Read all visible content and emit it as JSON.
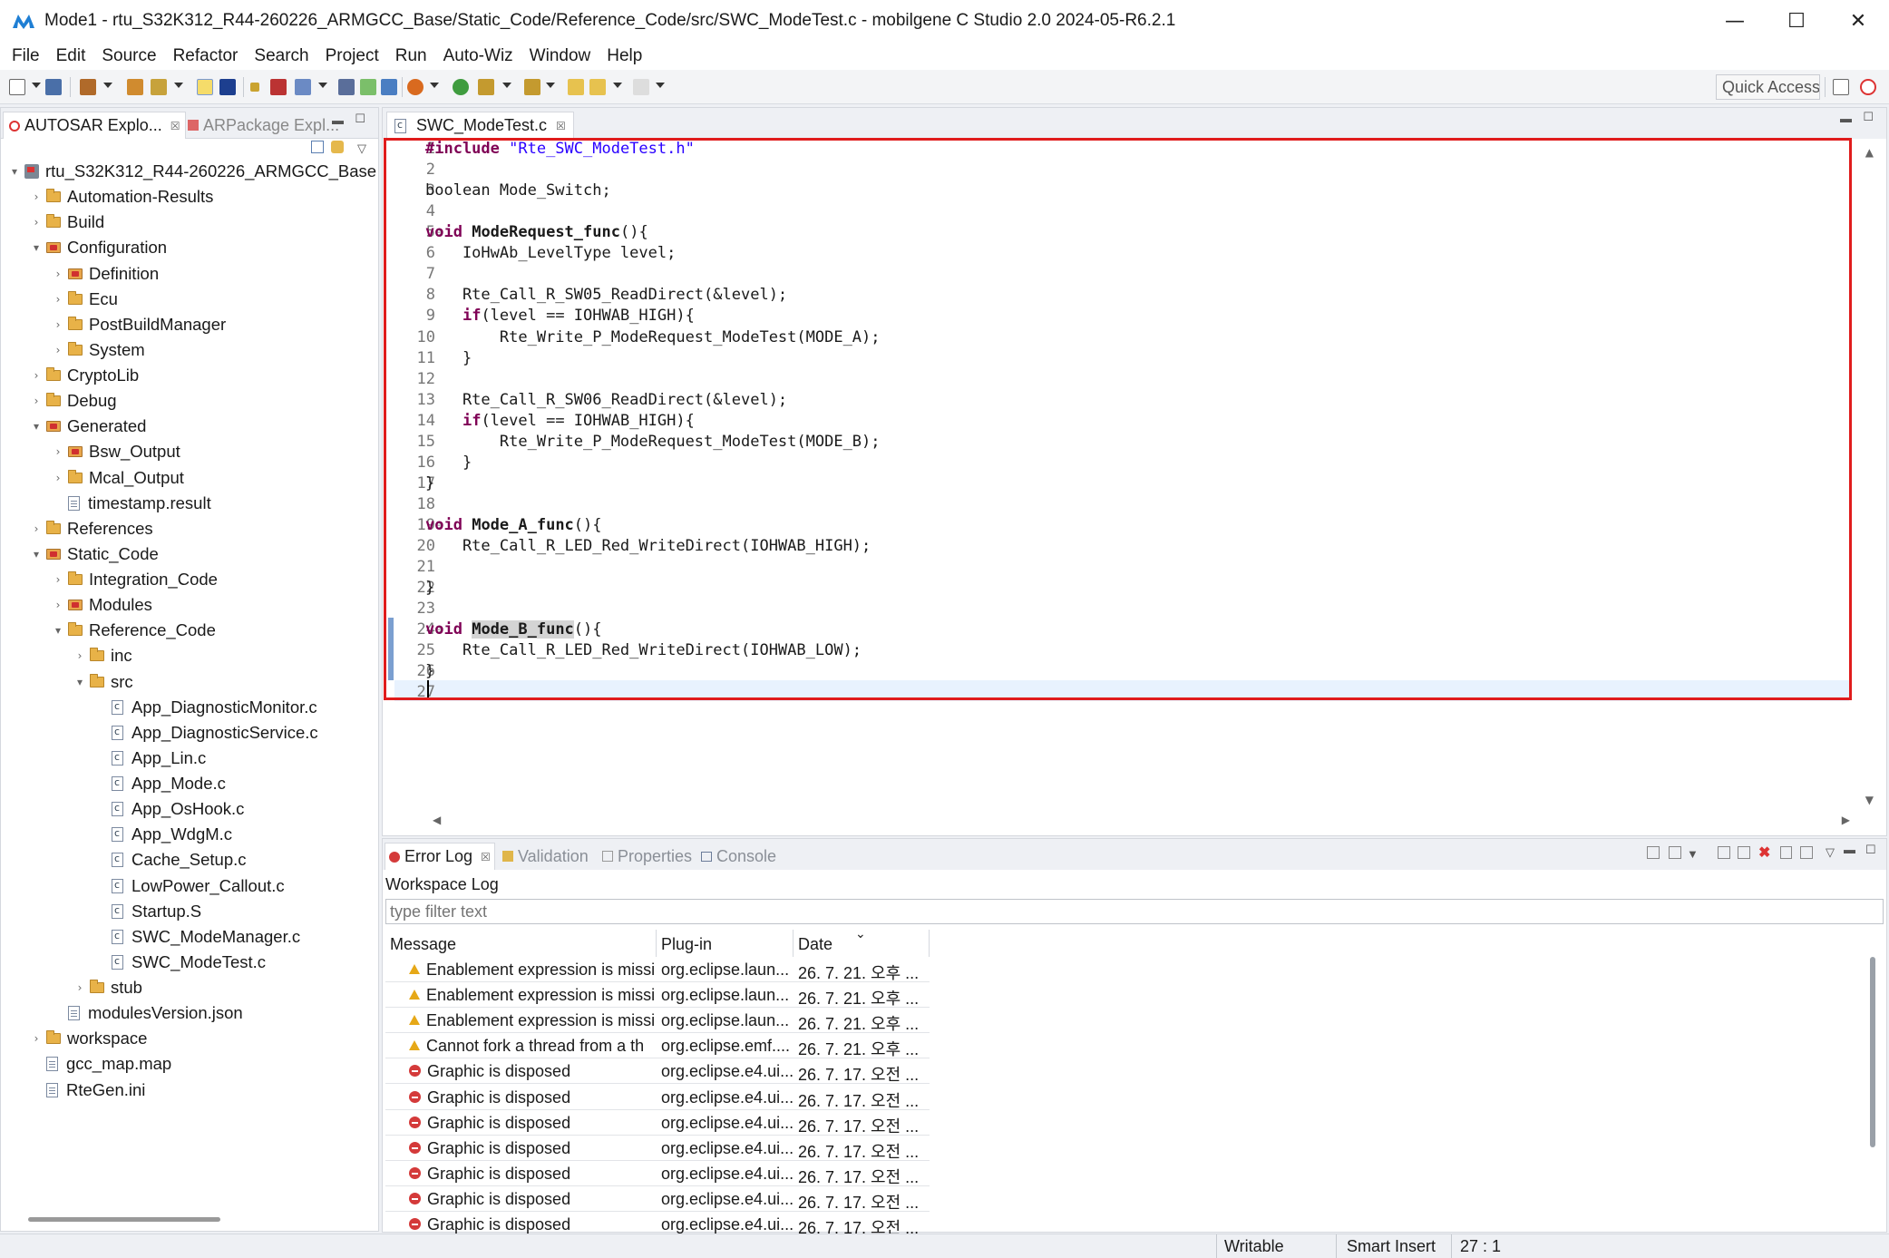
{
  "window": {
    "title": "Mode1 - rtu_S32K312_R44-260226_ARMGCC_Base/Static_Code/Reference_Code/src/SWC_ModeTest.c - mobilgene C Studio 2.0 2024-05-R6.2.1",
    "minimize": "—",
    "maximize": "☐",
    "close": "✕"
  },
  "menu": [
    "File",
    "Edit",
    "Source",
    "Refactor",
    "Search",
    "Project",
    "Run",
    "Auto-Wiz",
    "Window",
    "Help"
  ],
  "toolbar": {
    "quick_access": "Quick Access"
  },
  "left_panel": {
    "tabs": [
      {
        "label": "AUTOSAR Explo...",
        "close": "☒"
      },
      {
        "label": "ARPackage Expl...",
        "close": ""
      }
    ],
    "tree": [
      {
        "label": "rtu_S32K312_R44-260226_ARMGCC_Base",
        "depth": 0,
        "chev": "▾",
        "icon": "project-icon"
      },
      {
        "label": "Automation-Results",
        "depth": 1,
        "chev": "›",
        "icon": "folder-icon"
      },
      {
        "label": "Build",
        "depth": 1,
        "chev": "›",
        "icon": "folder-icon"
      },
      {
        "label": "Configuration",
        "depth": 1,
        "chev": "▾",
        "icon": "source-folder-icon"
      },
      {
        "label": "Definition",
        "depth": 2,
        "chev": "›",
        "icon": "source-folder-icon"
      },
      {
        "label": "Ecu",
        "depth": 2,
        "chev": "›",
        "icon": "folder-icon"
      },
      {
        "label": "PostBuildManager",
        "depth": 2,
        "chev": "›",
        "icon": "folder-icon"
      },
      {
        "label": "System",
        "depth": 2,
        "chev": "›",
        "icon": "folder-icon"
      },
      {
        "label": "CryptoLib",
        "depth": 1,
        "chev": "›",
        "icon": "folder-icon"
      },
      {
        "label": "Debug",
        "depth": 1,
        "chev": "›",
        "icon": "folder-icon"
      },
      {
        "label": "Generated",
        "depth": 1,
        "chev": "▾",
        "icon": "source-folder-icon"
      },
      {
        "label": "Bsw_Output",
        "depth": 2,
        "chev": "›",
        "icon": "source-folder-icon"
      },
      {
        "label": "Mcal_Output",
        "depth": 2,
        "chev": "›",
        "icon": "folder-icon"
      },
      {
        "label": "timestamp.result",
        "depth": 2,
        "chev": "",
        "icon": "file-icon"
      },
      {
        "label": "References",
        "depth": 1,
        "chev": "›",
        "icon": "folder-icon"
      },
      {
        "label": "Static_Code",
        "depth": 1,
        "chev": "▾",
        "icon": "source-folder-icon"
      },
      {
        "label": "Integration_Code",
        "depth": 2,
        "chev": "›",
        "icon": "folder-icon"
      },
      {
        "label": "Modules",
        "depth": 2,
        "chev": "›",
        "icon": "source-folder-icon"
      },
      {
        "label": "Reference_Code",
        "depth": 2,
        "chev": "▾",
        "icon": "folder-icon"
      },
      {
        "label": "inc",
        "depth": 3,
        "chev": "›",
        "icon": "folder-icon"
      },
      {
        "label": "src",
        "depth": 3,
        "chev": "▾",
        "icon": "folder-icon"
      },
      {
        "label": "App_DiagnosticMonitor.c",
        "depth": 4,
        "chev": "",
        "icon": "c-file-icon"
      },
      {
        "label": "App_DiagnosticService.c",
        "depth": 4,
        "chev": "",
        "icon": "c-file-icon"
      },
      {
        "label": "App_Lin.c",
        "depth": 4,
        "chev": "",
        "icon": "c-file-icon"
      },
      {
        "label": "App_Mode.c",
        "depth": 4,
        "chev": "",
        "icon": "c-file-icon"
      },
      {
        "label": "App_OsHook.c",
        "depth": 4,
        "chev": "",
        "icon": "c-file-icon"
      },
      {
        "label": "App_WdgM.c",
        "depth": 4,
        "chev": "",
        "icon": "c-file-icon"
      },
      {
        "label": "Cache_Setup.c",
        "depth": 4,
        "chev": "",
        "icon": "c-file-icon"
      },
      {
        "label": "LowPower_Callout.c",
        "depth": 4,
        "chev": "",
        "icon": "c-file-icon"
      },
      {
        "label": "Startup.S",
        "depth": 4,
        "chev": "",
        "icon": "c-file-icon"
      },
      {
        "label": "SWC_ModeManager.c",
        "depth": 4,
        "chev": "",
        "icon": "c-file-icon"
      },
      {
        "label": "SWC_ModeTest.c",
        "depth": 4,
        "chev": "",
        "icon": "c-file-icon"
      },
      {
        "label": "stub",
        "depth": 3,
        "chev": "›",
        "icon": "folder-icon"
      },
      {
        "label": "modulesVersion.json",
        "depth": 2,
        "chev": "",
        "icon": "file-icon"
      },
      {
        "label": "workspace",
        "depth": 1,
        "chev": "›",
        "icon": "folder-icon"
      },
      {
        "label": "gcc_map.map",
        "depth": 1,
        "chev": "",
        "icon": "file-icon"
      },
      {
        "label": "RteGen.ini",
        "depth": 1,
        "chev": "",
        "icon": "file-icon"
      }
    ]
  },
  "editor": {
    "tab_label": "SWC_ModeTest.c",
    "tab_close": "☒",
    "lines": [
      {
        "n": "1",
        "fold": "",
        "segs": [
          {
            "t": "#include ",
            "c": "kw"
          },
          {
            "t": "\"Rte_SWC_ModeTest.h\"",
            "c": "str"
          }
        ]
      },
      {
        "n": "2",
        "fold": "",
        "segs": []
      },
      {
        "n": "3",
        "fold": "",
        "segs": [
          {
            "t": "boolean Mode_Switch;",
            "c": ""
          }
        ]
      },
      {
        "n": "4",
        "fold": "",
        "segs": []
      },
      {
        "n": "5",
        "fold": "⊖",
        "segs": [
          {
            "t": "void",
            "c": "kw"
          },
          {
            "t": " ",
            "c": ""
          },
          {
            "t": "ModeRequest_func",
            "c": "fn"
          },
          {
            "t": "(){",
            "c": ""
          }
        ]
      },
      {
        "n": "6",
        "fold": "",
        "segs": [
          {
            "t": "    IoHwAb_LevelType level;",
            "c": ""
          }
        ]
      },
      {
        "n": "7",
        "fold": "",
        "segs": []
      },
      {
        "n": "8",
        "fold": "",
        "segs": [
          {
            "t": "    Rte_Call_R_SW05_ReadDirect(&level);",
            "c": ""
          }
        ]
      },
      {
        "n": "9",
        "fold": "",
        "segs": [
          {
            "t": "    ",
            "c": ""
          },
          {
            "t": "if",
            "c": "kw"
          },
          {
            "t": "(level == IOHWAB_HIGH){",
            "c": ""
          }
        ]
      },
      {
        "n": "10",
        "fold": "",
        "segs": [
          {
            "t": "        Rte_Write_P_ModeRequest_ModeTest(MODE_A);",
            "c": ""
          }
        ]
      },
      {
        "n": "11",
        "fold": "",
        "segs": [
          {
            "t": "    }",
            "c": ""
          }
        ]
      },
      {
        "n": "12",
        "fold": "",
        "segs": []
      },
      {
        "n": "13",
        "fold": "",
        "segs": [
          {
            "t": "    Rte_Call_R_SW06_ReadDirect(&level);",
            "c": ""
          }
        ]
      },
      {
        "n": "14",
        "fold": "",
        "segs": [
          {
            "t": "    ",
            "c": ""
          },
          {
            "t": "if",
            "c": "kw"
          },
          {
            "t": "(level == IOHWAB_HIGH){",
            "c": ""
          }
        ]
      },
      {
        "n": "15",
        "fold": "",
        "segs": [
          {
            "t": "        Rte_Write_P_ModeRequest_ModeTest(MODE_B);",
            "c": ""
          }
        ]
      },
      {
        "n": "16",
        "fold": "",
        "segs": [
          {
            "t": "    }",
            "c": ""
          }
        ]
      },
      {
        "n": "17",
        "fold": "",
        "segs": [
          {
            "t": "}",
            "c": ""
          }
        ]
      },
      {
        "n": "18",
        "fold": "",
        "segs": []
      },
      {
        "n": "19",
        "fold": "⊖",
        "segs": [
          {
            "t": "void",
            "c": "kw"
          },
          {
            "t": " ",
            "c": ""
          },
          {
            "t": "Mode_A_func",
            "c": "fn"
          },
          {
            "t": "(){",
            "c": ""
          }
        ]
      },
      {
        "n": "20",
        "fold": "",
        "segs": [
          {
            "t": "    Rte_Call_R_LED_Red_WriteDirect(IOHWAB_HIGH);",
            "c": ""
          }
        ]
      },
      {
        "n": "21",
        "fold": "",
        "segs": []
      },
      {
        "n": "22",
        "fold": "",
        "segs": [
          {
            "t": "}",
            "c": ""
          }
        ]
      },
      {
        "n": "23",
        "fold": "",
        "segs": []
      },
      {
        "n": "24",
        "fold": "⊖",
        "segs": [
          {
            "t": "void",
            "c": "kw"
          },
          {
            "t": " ",
            "c": ""
          },
          {
            "t": "Mode_B_func",
            "c": "fn hl"
          },
          {
            "t": "(){",
            "c": ""
          }
        ]
      },
      {
        "n": "25",
        "fold": "",
        "segs": [
          {
            "t": "    Rte_Call_R_LED_Red_WriteDirect(IOHWAB_LOW);",
            "c": ""
          }
        ]
      },
      {
        "n": "26",
        "fold": "",
        "segs": [
          {
            "t": "}",
            "c": ""
          }
        ]
      },
      {
        "n": "27",
        "fold": "",
        "segs": []
      }
    ]
  },
  "bottom_panel": {
    "tabs": [
      {
        "label": "Error Log",
        "close": "☒"
      },
      {
        "label": "Validation",
        "close": ""
      },
      {
        "label": "Properties",
        "close": ""
      },
      {
        "label": "Console",
        "close": ""
      }
    ],
    "workspace_log": "Workspace Log",
    "filter_placeholder": "type filter text",
    "columns": [
      "Message",
      "Plug-in",
      "Date"
    ],
    "sort_indicator": "⌄",
    "rows": [
      {
        "type": "warning",
        "message": "Enablement expression is missi",
        "plugin": "org.eclipse.laun...",
        "date": "26. 7. 21. 오후 ..."
      },
      {
        "type": "warning",
        "message": "Enablement expression is missi",
        "plugin": "org.eclipse.laun...",
        "date": "26. 7. 21. 오후 ..."
      },
      {
        "type": "warning",
        "message": "Enablement expression is missi",
        "plugin": "org.eclipse.laun...",
        "date": "26. 7. 21. 오후 ..."
      },
      {
        "type": "warning",
        "message": "Cannot fork a thread from a th",
        "plugin": "org.eclipse.emf....",
        "date": "26. 7. 21. 오후 ..."
      },
      {
        "type": "error",
        "message": "Graphic is disposed",
        "plugin": "org.eclipse.e4.ui...",
        "date": "26. 7. 17. 오전 ..."
      },
      {
        "type": "error",
        "message": "Graphic is disposed",
        "plugin": "org.eclipse.e4.ui...",
        "date": "26. 7. 17. 오전 ..."
      },
      {
        "type": "error",
        "message": "Graphic is disposed",
        "plugin": "org.eclipse.e4.ui...",
        "date": "26. 7. 17. 오전 ..."
      },
      {
        "type": "error",
        "message": "Graphic is disposed",
        "plugin": "org.eclipse.e4.ui...",
        "date": "26. 7. 17. 오전 ..."
      },
      {
        "type": "error",
        "message": "Graphic is disposed",
        "plugin": "org.eclipse.e4.ui...",
        "date": "26. 7. 17. 오전 ..."
      },
      {
        "type": "error",
        "message": "Graphic is disposed",
        "plugin": "org.eclipse.e4.ui...",
        "date": "26. 7. 17. 오전 ..."
      },
      {
        "type": "error",
        "message": "Graphic is disposed",
        "plugin": "org.eclipse.e4.ui...",
        "date": "26. 7. 17. 오전 ..."
      }
    ]
  },
  "status": {
    "writable": "Writable",
    "insert_mode": "Smart Insert",
    "position": "27 : 1"
  },
  "colors": {
    "keyword": "#7f0055",
    "string": "#2a00ff",
    "highlight_box": "#e01c1c",
    "warning": "#e6a817",
    "error": "#d43a3a"
  }
}
